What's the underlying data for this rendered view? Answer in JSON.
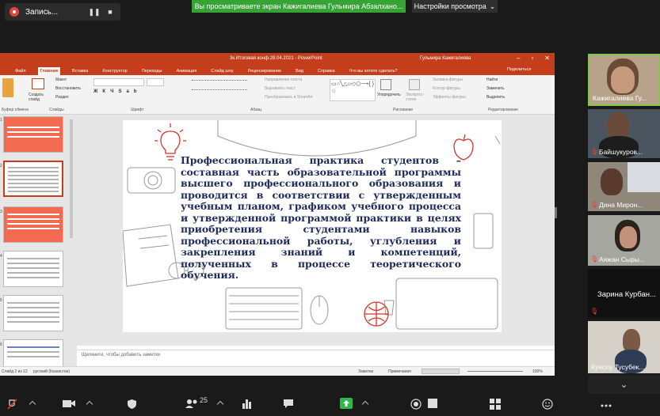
{
  "recording": {
    "label": "Запись...",
    "pause_icon": "pause-icon",
    "stop_icon": "stop-icon"
  },
  "share_banner": "Вы просматриваете экран Кажигалиева Гульмира Абзалхано...",
  "view_settings": {
    "label": "Настройки просмотра",
    "caret": "chevron-down-icon"
  },
  "ppt": {
    "title": "3к.Итоговая конф.28.04.2021 - PowerPoint",
    "user": "Гульмира Кажигалиева",
    "menu": [
      "Файл",
      "Главная",
      "Вставка",
      "Конструктор",
      "Переходы",
      "Анимация",
      "Слайд шоу",
      "Рецензирование",
      "Вид",
      "Справка",
      "Что вы хотите сделать?"
    ],
    "active_menu": "Главная",
    "share_label": "Поделиться",
    "ribbon": {
      "clipboard_caption": "Буфер обмена",
      "create_slide": "Создать слайд",
      "layout": "Макет",
      "reset": "Восстановить",
      "section": "Раздел",
      "slides_caption": "Слайды",
      "font_caption": "Шрифт",
      "paragraph_caption": "Абзац",
      "text_direction": "Направление текста",
      "align_text": "Выровнять текст",
      "smartart": "Преобразовать в SmartArt",
      "drawing_caption": "Рисование",
      "arrange": "Упорядочить",
      "quick_styles": "Экспресс-стили",
      "shape_fill": "Заливка фигуры",
      "shape_outline": "Контур фигуры",
      "shape_effects": "Эффекты фигуры",
      "find": "Найти",
      "replace": "Заменить",
      "select": "Выделить",
      "editing_caption": "Редактирование"
    },
    "thumb_numbers": [
      "1",
      "2",
      "3",
      "4",
      "5",
      "6"
    ],
    "slide_text": "Профессиональная практика студентов – составная часть образовательной программы высшего профессионального образования и проводится в соответствии с утвержденным учебным планом, графиком учебного процесса и утвержденной программой практики в целях приобретения студентами навыков профессиональной работы, углубления и закрепления знаний и компетенций, полученных в процессе теоретического обучения.",
    "notes_placeholder": "Щелкните, чтобы добавить заметки",
    "status": {
      "slide": "Слайд 2 из 12",
      "language": "русский (Казахстан)",
      "notes": "Заметки",
      "comments": "Примечания",
      "zoom": "100%"
    }
  },
  "participants": [
    {
      "name": "Кажигалиева Гу...",
      "muted": false
    },
    {
      "name": "Байшукуров...",
      "muted": true
    },
    {
      "name": "Дина Мирон...",
      "muted": true
    },
    {
      "name": "Аяжан Сыры...",
      "muted": true
    },
    {
      "name": "Зарина Курбан...",
      "muted": true
    },
    {
      "name": "Кунслу Тусубек...",
      "muted": true
    }
  ],
  "toolbar": {
    "participants_count": "25"
  }
}
